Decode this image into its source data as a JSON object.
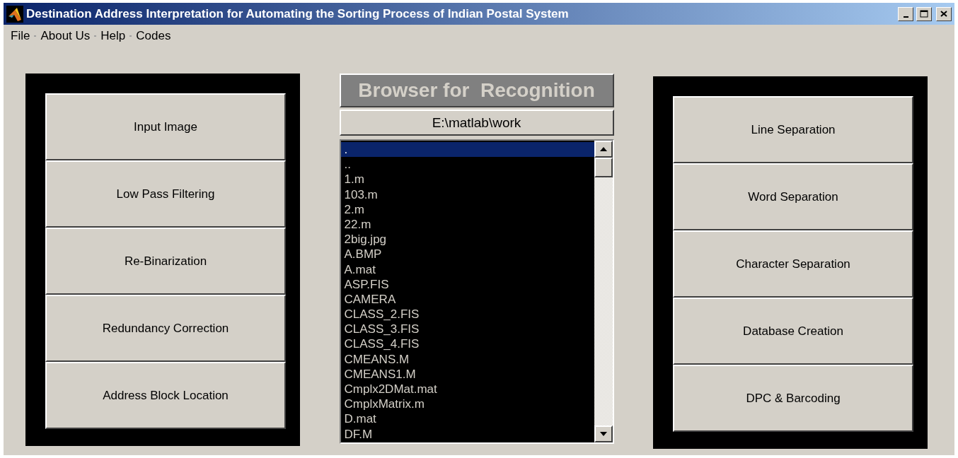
{
  "window": {
    "title": "Destination Address Interpretation for Automating the Sorting Process of Indian Postal System"
  },
  "menu": [
    "File",
    "About Us",
    "Help",
    "Codes"
  ],
  "left_panel": {
    "buttons": [
      "Input Image",
      "Low Pass Filtering",
      "Re-Binarization",
      "Redundancy Correction",
      "Address Block Location"
    ]
  },
  "browser": {
    "title": "Browser for  Recognition",
    "path": "E:\\matlab\\work",
    "files": [
      {
        "name": ".",
        "selected": true
      },
      {
        "name": "..",
        "selected": false
      },
      {
        "name": "1.m",
        "selected": false
      },
      {
        "name": "103.m",
        "selected": false
      },
      {
        "name": "2.m",
        "selected": false
      },
      {
        "name": "22.m",
        "selected": false
      },
      {
        "name": "2big.jpg",
        "selected": false
      },
      {
        "name": "A.BMP",
        "selected": false
      },
      {
        "name": "A.mat",
        "selected": false
      },
      {
        "name": "ASP.FIS",
        "selected": false
      },
      {
        "name": "CAMERA",
        "selected": false
      },
      {
        "name": "CLASS_2.FIS",
        "selected": false
      },
      {
        "name": "CLASS_3.FIS",
        "selected": false
      },
      {
        "name": "CLASS_4.FIS",
        "selected": false
      },
      {
        "name": "CMEANS.M",
        "selected": false
      },
      {
        "name": "CMEANS1.M",
        "selected": false
      },
      {
        "name": "Cmplx2DMat.mat",
        "selected": false
      },
      {
        "name": "CmplxMatrix.m",
        "selected": false
      },
      {
        "name": "D.mat",
        "selected": false
      },
      {
        "name": "DF.M",
        "selected": false
      }
    ]
  },
  "right_panel": {
    "buttons": [
      "Line Separation",
      "Word Separation",
      "Character Separation",
      "Database Creation",
      "DPC &  Barcoding"
    ]
  }
}
